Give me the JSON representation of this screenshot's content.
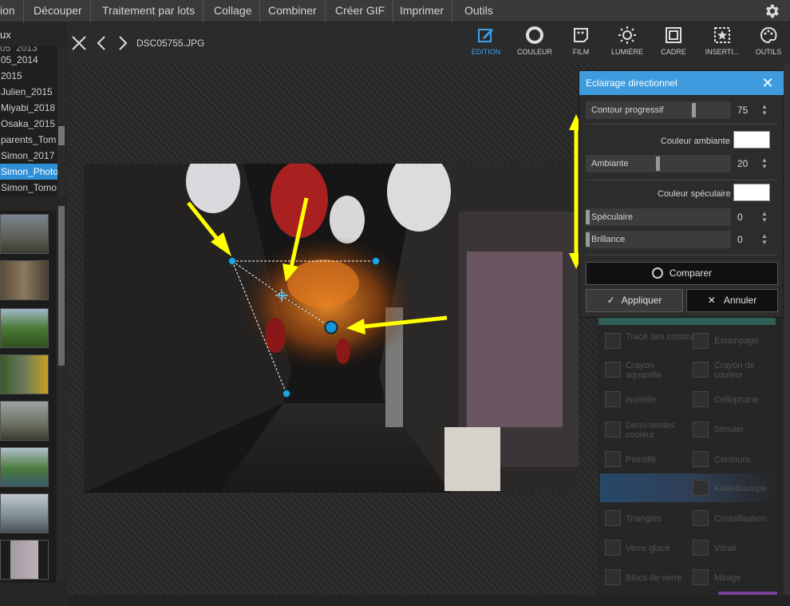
{
  "menubar": {
    "items": [
      "ion",
      "Découper",
      "Traitement par lots",
      "Collage",
      "Combiner",
      "Créer GIF",
      "Imprimer",
      "Outils"
    ],
    "settings_icon": "gear-icon"
  },
  "leftpanel": {
    "header": "ux",
    "folders": [
      "05_2014",
      "2015",
      "Julien_2015",
      "Miyabi_2018",
      "Osaka_2015",
      "parents_Tom",
      "Simon_2017",
      "Simon_Photo",
      "Simon_Tomo"
    ],
    "selected_folder": "Simon_Photo",
    "collapse_icon": "chevron-left-icon"
  },
  "navbar": {
    "close_icon": "close-icon",
    "prev_icon": "chevron-left-icon",
    "next_icon": "chevron-right-icon",
    "filename": "DSC05755.JPG"
  },
  "toolbar": {
    "tools": [
      {
        "label": "EDITION",
        "icon": "edit-icon",
        "active": true
      },
      {
        "label": "COULEUR",
        "icon": "color-circle-icon",
        "active": false
      },
      {
        "label": "FILM",
        "icon": "film-icon",
        "active": false
      },
      {
        "label": "LUMIÈRE",
        "icon": "sun-icon",
        "active": false
      },
      {
        "label": "CADRE",
        "icon": "frame-icon",
        "active": false
      },
      {
        "label": "INSERTI...",
        "icon": "insert-star-icon",
        "active": false
      },
      {
        "label": "OUTILS",
        "icon": "palette-icon",
        "active": false
      }
    ],
    "accent_color": "#3ea0ea"
  },
  "dialog": {
    "title": "Eclairage directionnel",
    "close_icon": "close-icon",
    "contour_label": "Contour progressif",
    "contour_value": "75",
    "ambient_color_label": "Couleur ambiante",
    "ambiante_label": "Ambiante",
    "ambiante_value": "20",
    "specular_color_label": "Couleur spéculaire",
    "speculaire_label": "Spéculaire",
    "speculaire_value": "0",
    "brillance_label": "Brillance",
    "brillance_value": "0",
    "compare_label": "Comparer",
    "apply_label": "Appliquer",
    "cancel_label": "Annuler"
  },
  "effects": [
    "Tracé des contours",
    "Estampage",
    "Crayon aquarelle",
    "Crayon de couleur",
    "Isohélie",
    "Cellophane",
    "Demi-teintes couleur",
    "Simuler",
    "Pointillé",
    "Contours",
    "",
    "Kaléidoscope",
    "Triangles",
    "Cristallisation",
    "Verre glacé",
    "Vitrail",
    "Blocs de verre",
    "Mirage"
  ]
}
